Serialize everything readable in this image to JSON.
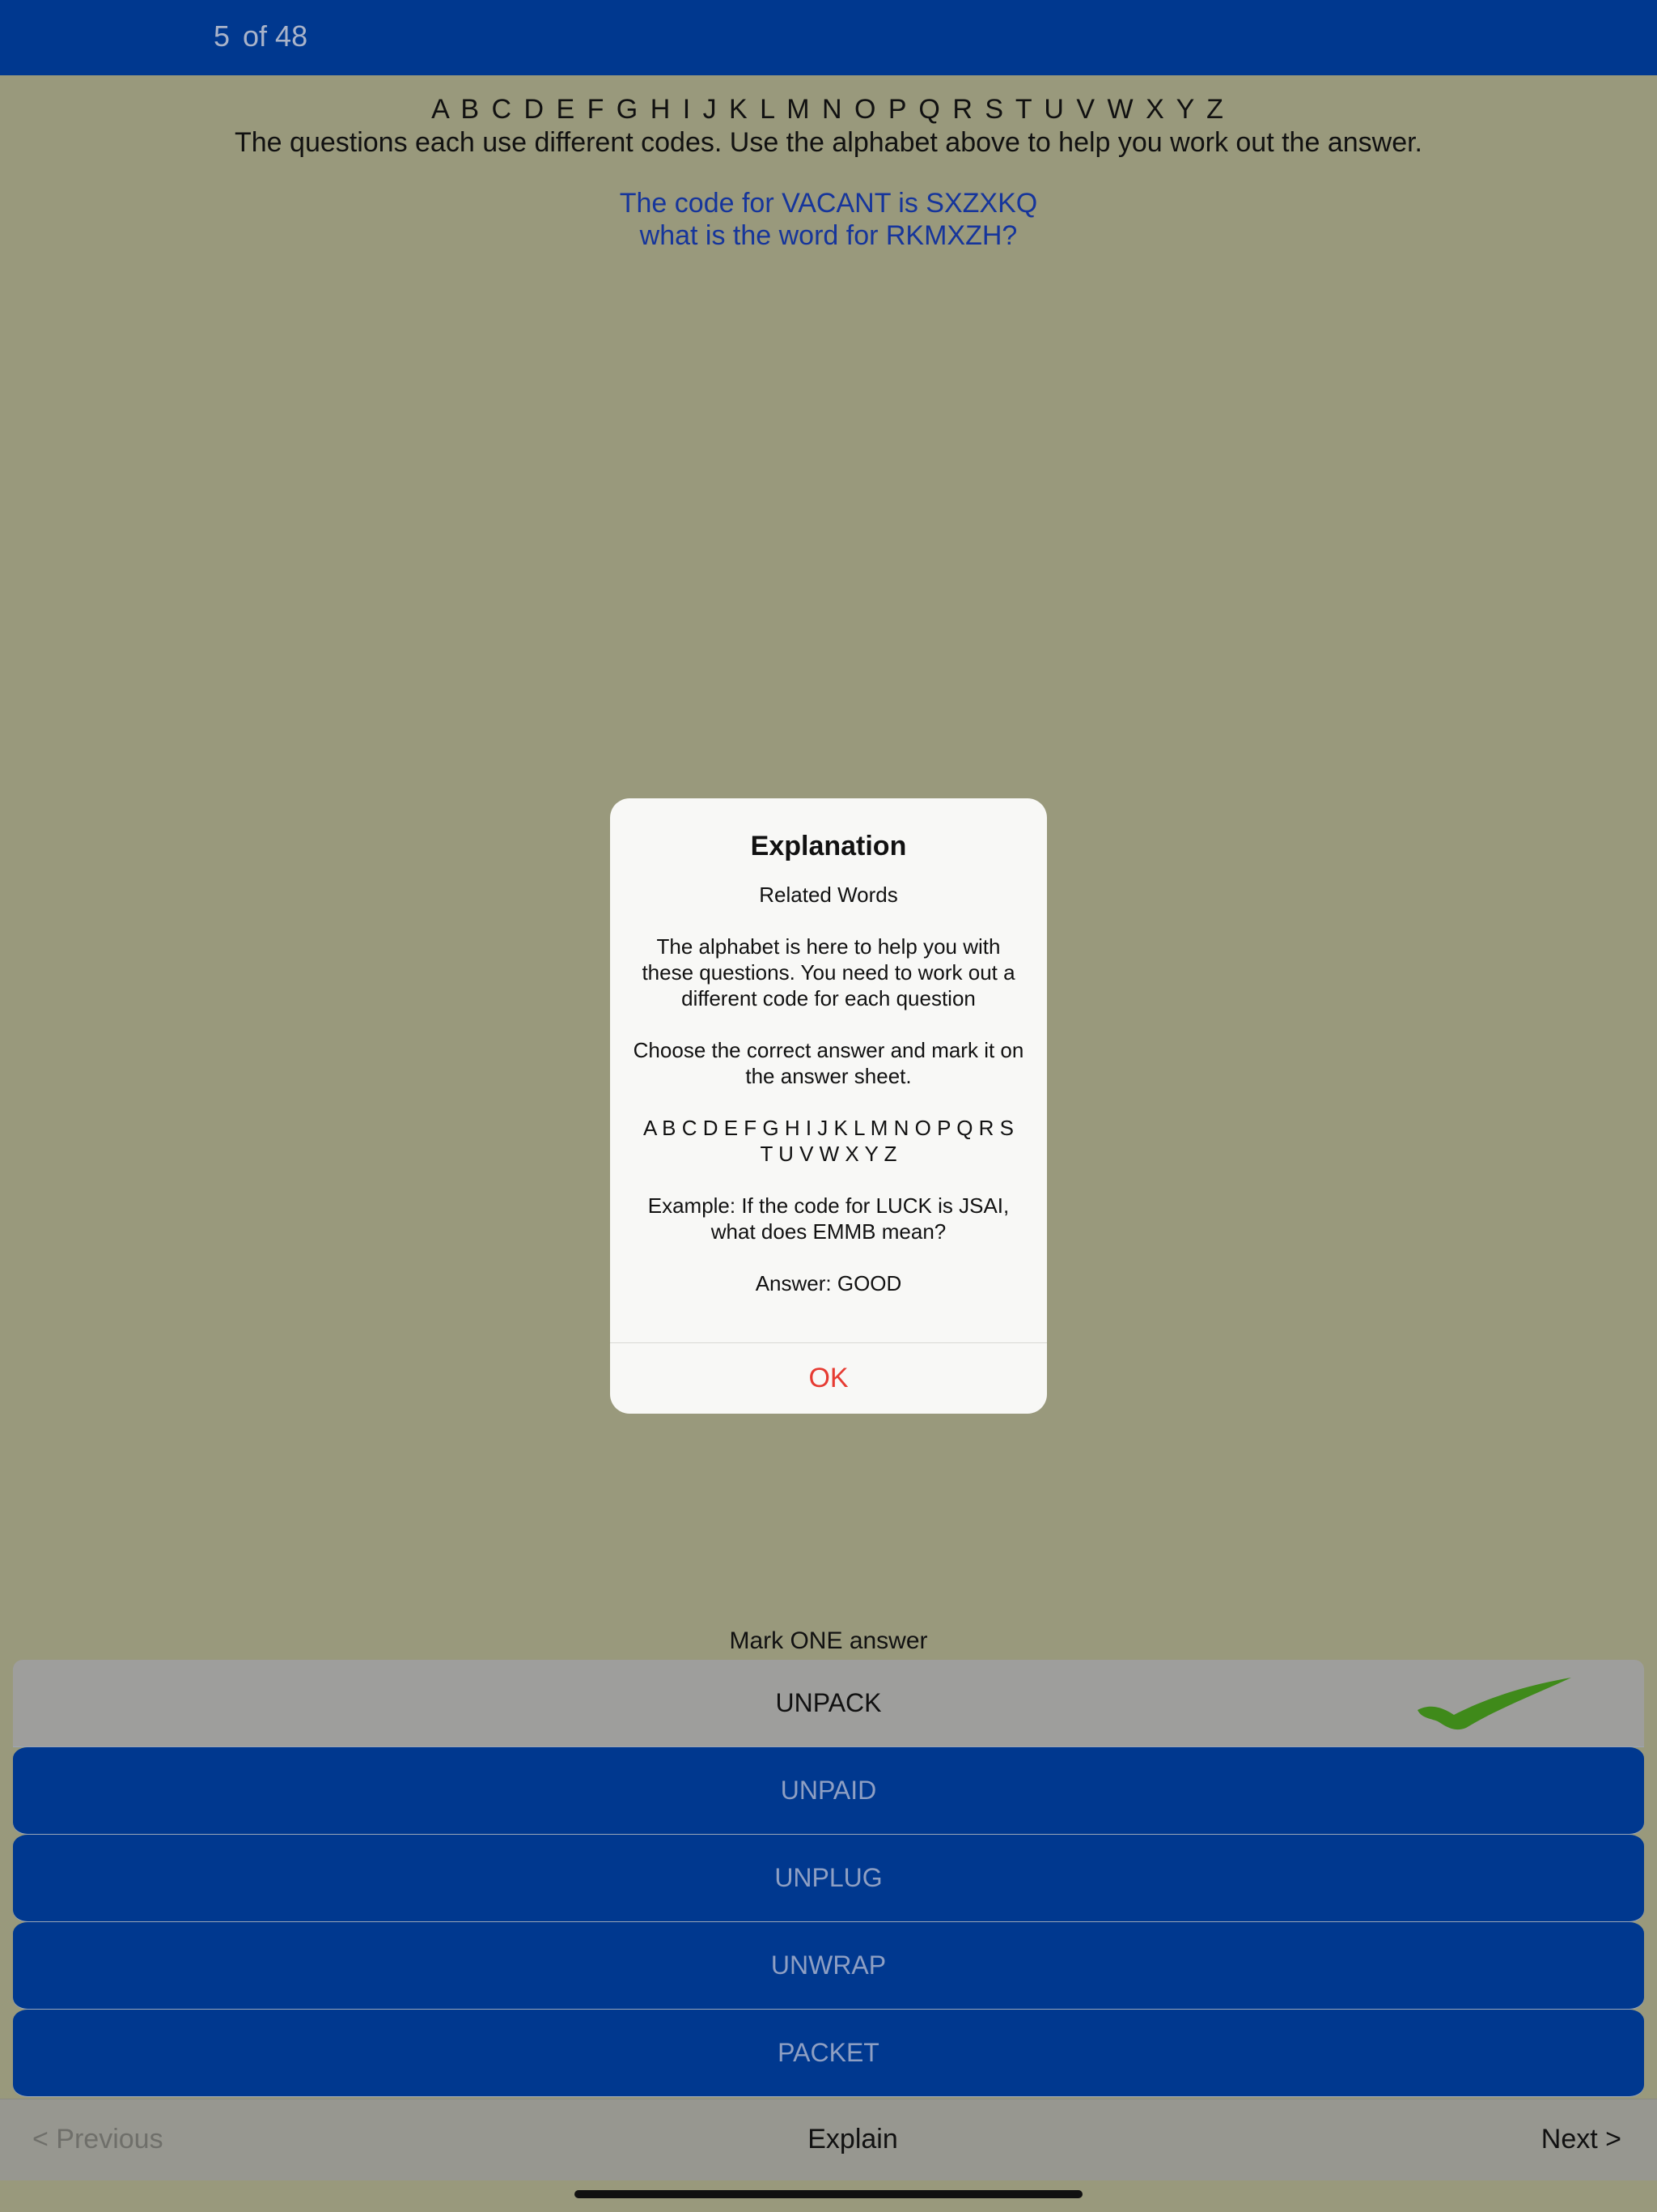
{
  "header": {
    "question_number": "5",
    "total_label": "of 48"
  },
  "alphabet_line": "A B C D E F G H I J K L M N O P Q R S T U V W X Y Z",
  "instructions": "The questions each use different codes. Use the alphabet above to help you work out the answer.",
  "question": {
    "line1": "The code for VACANT is SXZXKQ",
    "line2": "what is the word for RKMXZH?"
  },
  "mark_label": "Mark ONE answer",
  "answers": [
    {
      "label": "UNPACK",
      "selected": true
    },
    {
      "label": "UNPAID",
      "selected": false
    },
    {
      "label": "UNPLUG",
      "selected": false
    },
    {
      "label": "UNWRAP",
      "selected": false
    },
    {
      "label": "PACKET",
      "selected": false
    }
  ],
  "nav": {
    "previous": "< Previous",
    "explain": "Explain",
    "next": "Next >"
  },
  "dialog": {
    "title": "Explanation",
    "subtitle": "Related Words",
    "paragraph1": "The alphabet is here to help you with these questions. You need to work out a different code for each question",
    "paragraph2": "Choose the correct answer and mark it on the answer sheet.",
    "alphabet_line1": "A B C D E F G H I J K L M N O P Q R S",
    "alphabet_line2": "T U V W X Y Z",
    "example_line1": "Example: If the code for LUCK is JSAI,",
    "example_line2": "what does EMMB mean?",
    "answer": "Answer: GOOD",
    "ok_label": "OK"
  },
  "colors": {
    "background": "#99997c",
    "header_blue": "#00388f",
    "question_blue": "#16359b",
    "ok_red": "#e63b32",
    "check_green": "#3f8a1a"
  },
  "icons": {
    "selected_marker": "checkmark-icon"
  }
}
